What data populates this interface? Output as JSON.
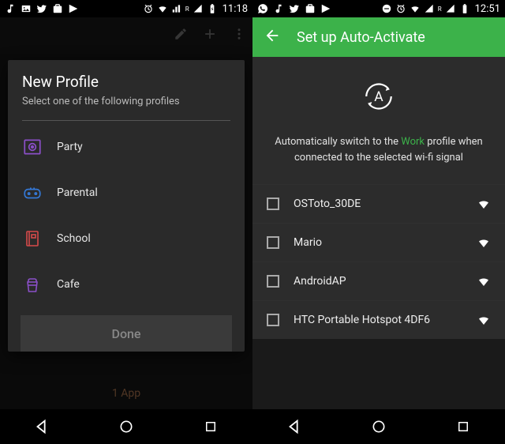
{
  "left": {
    "status": {
      "time": "11:18"
    },
    "dialog": {
      "title": "New Profile",
      "subtitle": "Select one of the following profiles",
      "profiles": [
        {
          "label": "Party"
        },
        {
          "label": "Parental"
        },
        {
          "label": "School"
        },
        {
          "label": "Cafe"
        }
      ],
      "done": "Done"
    },
    "behind_text": "1 App"
  },
  "right": {
    "status": {
      "time": "12:51"
    },
    "toolbar": {
      "title": "Set up Auto-Activate"
    },
    "hero": {
      "text_pre": "Automatically switch to the ",
      "text_accent": "Work",
      "text_post": " profile when connected to the selected wi-fi signal"
    },
    "wifi": [
      {
        "name": "OSToto_30DE"
      },
      {
        "name": "Mario"
      },
      {
        "name": "AndroidAP"
      },
      {
        "name": "HTC Portable Hotspot 4DF6"
      }
    ]
  },
  "colors": {
    "green": "#3cb24a",
    "purple": "#8a4fc7",
    "blue": "#3478d6",
    "red": "#d64a4a"
  }
}
